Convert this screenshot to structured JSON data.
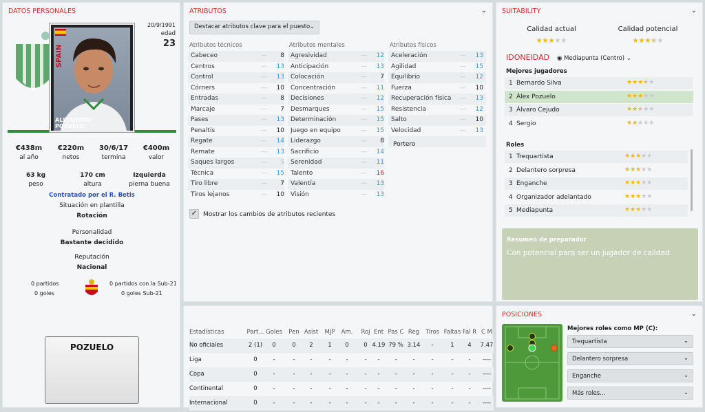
{
  "personal": {
    "header": "DATOS PERSONALES",
    "birthdate": "20/9/1991",
    "age_label": "edad",
    "age": "23",
    "card_name_line1": "ALEJANDRO",
    "card_name_line2": "POZUELO",
    "flag_text": "SPAIN",
    "contract": [
      {
        "value": "€438m",
        "label": "al año"
      },
      {
        "value": "€220m",
        "label": "netos"
      },
      {
        "value": "30/6/17",
        "label": "termina"
      },
      {
        "value": "€400m",
        "label": "valor"
      }
    ],
    "physical": [
      {
        "value": "63 kg",
        "label": "peso"
      },
      {
        "value": "170 cm",
        "label": "altura"
      },
      {
        "value": "Izquierda",
        "label": "pierna buena"
      }
    ],
    "contracted_by": "Contratado por el R. Betis",
    "squad_status_label": "Situación en plantilla",
    "squad_status": "Rotación",
    "personality_label": "Personalidad",
    "personality": "Bastante decidido",
    "reputation_label": "Reputación",
    "reputation": "Nacional",
    "intl_left_1": "0 partidos",
    "intl_left_2": "0 goles",
    "intl_right_1": "0 partidos con la Sub-21",
    "intl_right_2": "0 goles Sub-21",
    "shirt_name": "POZUELO"
  },
  "attributes": {
    "header": "ATRIBUTOS",
    "highlight_dropdown": "Destacar atributos clave para el puesto",
    "tech_header": "Atributos técnicos",
    "mental_header": "Atributos mentales",
    "physical_header": "Atributos físicos",
    "technical": [
      {
        "name": "Cabeceo",
        "value": "8",
        "color": "#222222"
      },
      {
        "name": "Centros",
        "value": "13",
        "color": "#3a9ad9"
      },
      {
        "name": "Control",
        "value": "13",
        "color": "#3a9ad9"
      },
      {
        "name": "Córners",
        "value": "10",
        "color": "#222222"
      },
      {
        "name": "Entradas",
        "value": "8",
        "color": "#222222"
      },
      {
        "name": "Marcaje",
        "value": "7",
        "color": "#222222"
      },
      {
        "name": "Pases",
        "value": "13",
        "color": "#3a9ad9"
      },
      {
        "name": "Penaltis",
        "value": "10",
        "color": "#222222"
      },
      {
        "name": "Regate",
        "value": "14",
        "color": "#3a9ad9"
      },
      {
        "name": "Remate",
        "value": "13",
        "color": "#3a9ad9"
      },
      {
        "name": "Saques largos",
        "value": "5",
        "color": "#b9c1c4"
      },
      {
        "name": "Técnica",
        "value": "15",
        "color": "#3a9ad9"
      },
      {
        "name": "Tiro libre",
        "value": "7",
        "color": "#222222"
      },
      {
        "name": "Tiros lejanos",
        "value": "10",
        "color": "#222222"
      }
    ],
    "mental": [
      {
        "name": "Agresividad",
        "value": "12",
        "color": "#3a9ad9"
      },
      {
        "name": "Anticipación",
        "value": "13",
        "color": "#3a9ad9"
      },
      {
        "name": "Colocación",
        "value": "7",
        "color": "#222222"
      },
      {
        "name": "Concentración",
        "value": "11",
        "color": "#3a9ad9"
      },
      {
        "name": "Decisiones",
        "value": "12",
        "color": "#3a9ad9"
      },
      {
        "name": "Desmarques",
        "value": "15",
        "color": "#3a9ad9"
      },
      {
        "name": "Determinación",
        "value": "15",
        "color": "#3a9ad9"
      },
      {
        "name": "Juego en equipo",
        "value": "15",
        "color": "#3a9ad9"
      },
      {
        "name": "Liderazgo",
        "value": "8",
        "color": "#222222"
      },
      {
        "name": "Sacrificio",
        "value": "14",
        "color": "#3a9ad9"
      },
      {
        "name": "Serenidad",
        "value": "11",
        "color": "#3a9ad9"
      },
      {
        "name": "Talento",
        "value": "16",
        "color": "#e02020"
      },
      {
        "name": "Valentía",
        "value": "13",
        "color": "#3a9ad9"
      },
      {
        "name": "Visión",
        "value": "13",
        "color": "#3a9ad9"
      }
    ],
    "physical": [
      {
        "name": "Aceleración",
        "value": "13",
        "color": "#3a9ad9"
      },
      {
        "name": "Agilidad",
        "value": "15",
        "color": "#3a9ad9"
      },
      {
        "name": "Equilibrio",
        "value": "12",
        "color": "#3a9ad9"
      },
      {
        "name": "Fuerza",
        "value": "10",
        "color": "#222222"
      },
      {
        "name": "Recuperación física",
        "value": "13",
        "color": "#3a9ad9"
      },
      {
        "name": "Resistencia",
        "value": "12",
        "color": "#3a9ad9"
      },
      {
        "name": "Salto",
        "value": "10",
        "color": "#222222"
      },
      {
        "name": "Velocidad",
        "value": "13",
        "color": "#3a9ad9"
      }
    ],
    "goalkeeper_label": "Portero",
    "show_changes_label": "Mostrar los cambios de atributos recientes"
  },
  "stats": {
    "headers": [
      "Estadísticas",
      "Part...",
      "Goles",
      "Pen",
      "Asist",
      "MJP",
      "Am.",
      "Roj",
      "Ent",
      "Pas C",
      "Reg",
      "Tiros",
      "Faltas",
      "Fal R",
      "C M"
    ],
    "rows": [
      [
        "No oficiales",
        "2 (1)",
        "0",
        "0",
        "2",
        "1",
        "0",
        "0",
        "4.19",
        "79 %",
        "3.14",
        "-",
        "1",
        "4",
        "7.47"
      ],
      [
        "Liga",
        "0",
        "-",
        "-",
        "-",
        "-",
        "-",
        "-",
        "-",
        "-",
        "-",
        "-",
        "-",
        "-",
        "----"
      ],
      [
        "Copa",
        "0",
        "-",
        "-",
        "-",
        "-",
        "-",
        "-",
        "-",
        "-",
        "-",
        "-",
        "-",
        "-",
        "----"
      ],
      [
        "Continental",
        "0",
        "-",
        "-",
        "-",
        "-",
        "-",
        "-",
        "-",
        "-",
        "-",
        "-",
        "-",
        "-",
        "----"
      ],
      [
        "Internacional",
        "0",
        "-",
        "-",
        "-",
        "-",
        "-",
        "-",
        "-",
        "-",
        "-",
        "-",
        "-",
        "-",
        "----"
      ]
    ]
  },
  "suitability": {
    "header": "SUITABILITY",
    "current_label": "Calidad actual",
    "potential_label": "Calidad potencial",
    "current_stars": 3,
    "potential_stars": 3.5,
    "suitability_label": "IDONEIDAD",
    "position_dropdown": "Mediapunta (Centro)",
    "best_players_label": "Mejores jugadores",
    "best_players": [
      {
        "rank": "1",
        "name": "Bernardo Silva",
        "stars": 3.5
      },
      {
        "rank": "2",
        "name": "Álex Pozuelo",
        "stars": 3
      },
      {
        "rank": "3",
        "name": "Álvaro Cejudo",
        "stars": 2.5
      },
      {
        "rank": "4",
        "name": "Sergio",
        "stars": 2
      }
    ],
    "roles_label": "Roles",
    "roles": [
      {
        "rank": "1",
        "name": "Trequartista",
        "stars": 3
      },
      {
        "rank": "2",
        "name": "Delantero sorpresa",
        "stars": 3
      },
      {
        "rank": "3",
        "name": "Enganche",
        "stars": 3
      },
      {
        "rank": "4",
        "name": "Organizador adelantado",
        "stars": 3
      },
      {
        "rank": "5",
        "name": "Mediapunta",
        "stars": 3
      }
    ],
    "coach_title": "Resumen de preparador",
    "coach_text": "Con potencial para ser un jugador de calidad."
  },
  "positions": {
    "header": "POSICIONES",
    "best_roles_label": "Mejores roles como MP (C):",
    "role_buttons": [
      "Trequartista",
      "Delantero sorpresa",
      "Enganche",
      "Más roles..."
    ]
  },
  "colors": {
    "accent": "#d22a2a",
    "highlight": "#3a9ad9",
    "selected_row": "#cfe6cd",
    "coach_bg": "#c6d1b6",
    "pitch": "#4e9a3a"
  }
}
